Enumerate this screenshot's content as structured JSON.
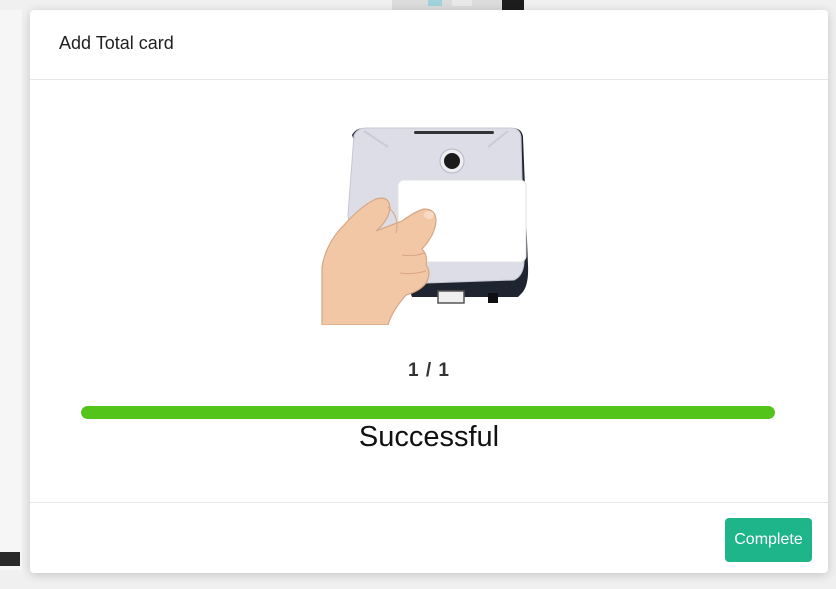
{
  "dialog": {
    "title": "Add Total card"
  },
  "progress": {
    "counter_text": "1 / 1",
    "fraction": 1.0,
    "bar_color": "#52c41a"
  },
  "status": {
    "message": "Successful"
  },
  "footer": {
    "complete_label": "Complete",
    "complete_color": "#1fb58a"
  },
  "illustration": {
    "icon": "card-reader-hand-icon"
  }
}
